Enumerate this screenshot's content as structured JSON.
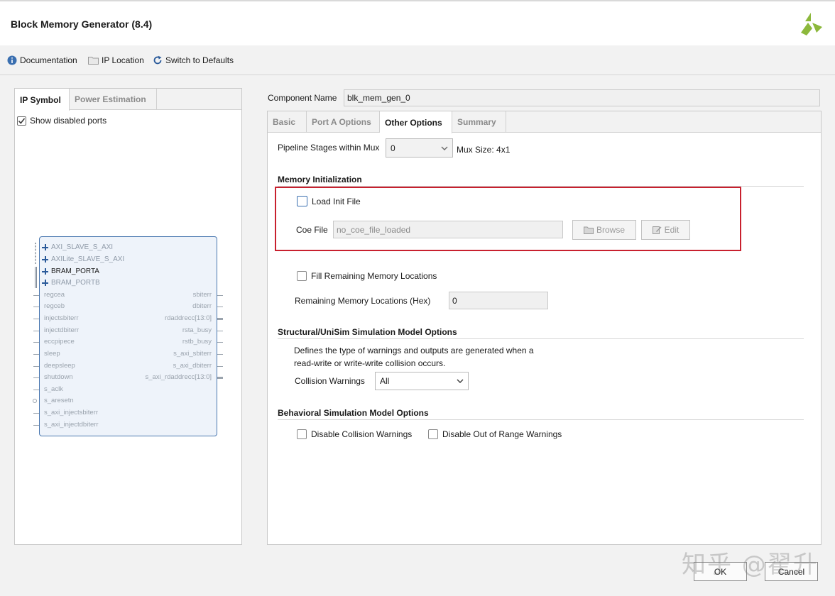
{
  "window": {
    "title": "Block Memory Generator (8.4)"
  },
  "toolbar": {
    "documentation": "Documentation",
    "ip_location": "IP Location",
    "switch_defaults": "Switch to Defaults"
  },
  "left_tabs": [
    "IP Symbol",
    "Power Estimation"
  ],
  "show_disabled_ports": {
    "label": "Show disabled ports",
    "checked": true
  },
  "symbol": {
    "buses": [
      "AXI_SLAVE_S_AXI",
      "AXILite_SLAVE_S_AXI",
      "BRAM_PORTA",
      "BRAM_PORTB"
    ],
    "left_pins": [
      "regcea",
      "regceb",
      "injectsbiterr",
      "injectdbiterr",
      "eccpipece",
      "sleep",
      "deepsleep",
      "shutdown",
      "s_aclk",
      "s_aresetn",
      "s_axi_injectsbiterr",
      "s_axi_injectdbiterr"
    ],
    "right_pins": [
      "sbiterr",
      "dbiterr",
      "rdaddrecc[13:0]",
      "rsta_busy",
      "rstb_busy",
      "s_axi_sbiterr",
      "s_axi_dbiterr",
      "s_axi_rdaddrecc[13:0]"
    ]
  },
  "component": {
    "label": "Component Name",
    "value": "blk_mem_gen_0"
  },
  "right_tabs": [
    "Basic",
    "Port A Options",
    "Other Options",
    "Summary"
  ],
  "pipeline": {
    "label": "Pipeline Stages within Mux",
    "value": "0",
    "mux_size": "Mux Size: 4x1"
  },
  "memory_init": {
    "title": "Memory Initialization",
    "load_init_label": "Load Init File",
    "coe_label": "Coe File",
    "coe_placeholder": "no_coe_file_loaded",
    "browse": "Browse",
    "edit": "Edit"
  },
  "fill_remaining": {
    "label": "Fill Remaining Memory Locations",
    "checked": false
  },
  "remaining": {
    "label": "Remaining Memory Locations (Hex)",
    "value": "0"
  },
  "structural": {
    "title": "Structural/UniSim Simulation Model Options",
    "desc_line1": "Defines the type of warnings and outputs are generated when a",
    "desc_line2": "read-write or write-write collision occurs.",
    "collision_label": "Collision Warnings",
    "collision_value": "All"
  },
  "behavioral": {
    "title": "Behavioral Simulation Model Options",
    "disable_collision": "Disable Collision Warnings",
    "disable_range": "Disable Out of Range Warnings"
  },
  "footer": {
    "ok": "OK",
    "cancel": "Cancel"
  },
  "watermark": "知乎 @翟升",
  "colors": {
    "highlight": "#c8202e",
    "symbol_border": "#4a78b0",
    "logo": "#8cb83c"
  }
}
